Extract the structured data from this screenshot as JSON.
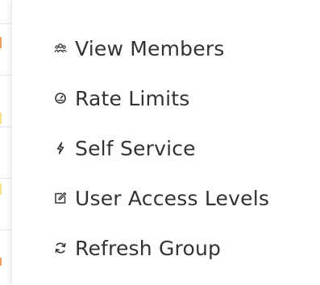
{
  "menu": {
    "items": [
      {
        "label": "View Members",
        "icon": "users-icon"
      },
      {
        "label": "Rate Limits",
        "icon": "dashboard-gauge-icon"
      },
      {
        "label": "Self Service",
        "icon": "lightning-icon"
      },
      {
        "label": "User Access Levels",
        "icon": "edit-icon"
      },
      {
        "label": "Refresh Group",
        "icon": "refresh-icon"
      }
    ]
  },
  "colors": {
    "text": "#333333",
    "edge_accent_orange": "#f0a05a",
    "edge_accent_yellow": "#f5e08a"
  }
}
